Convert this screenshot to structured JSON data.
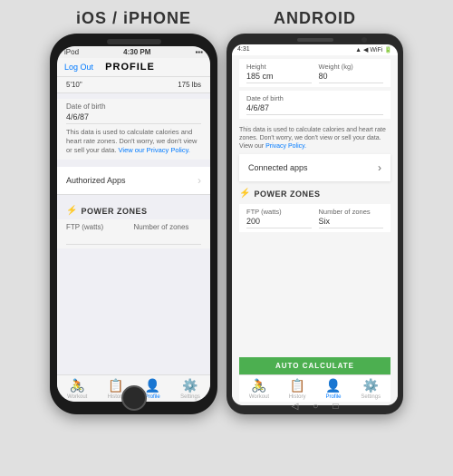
{
  "page": {
    "background": "#e0e0e0"
  },
  "ios": {
    "platform_title": "iOS / iPHONE",
    "status_bar": {
      "left": "iPod",
      "center": "4:30 PM",
      "right": "🔋"
    },
    "nav": {
      "back_label": "Log Out",
      "title": "PROFILE"
    },
    "profile": {
      "height_label": "5'10\"",
      "weight_label": "175 lbs"
    },
    "dob": {
      "label": "Date of birth",
      "value": "4/6/87"
    },
    "info_text": "This data is used to calculate calories and heart rate zones. Don't worry, we don't view or sell your data.",
    "privacy_link": "View our Privacy Policy.",
    "authorized_apps": {
      "label": "Authorized Apps"
    },
    "power_zones": {
      "header": "POWER ZONES",
      "ftp_label": "FTP (watts)",
      "ftp_value": "",
      "zones_label": "Number of zones",
      "zones_value": ""
    },
    "tabs": [
      {
        "icon": "🚴",
        "label": "Workout",
        "active": false
      },
      {
        "icon": "📋",
        "label": "History",
        "active": false
      },
      {
        "icon": "👤",
        "label": "Profile",
        "active": true
      },
      {
        "icon": "⚙️",
        "label": "Settings",
        "active": false
      }
    ]
  },
  "android": {
    "platform_title": "ANDROID",
    "status_bar": {
      "left": "4:31",
      "right": "▲ ◀ WiFi 🔋"
    },
    "profile": {
      "height_label": "Height",
      "height_value": "185 cm",
      "weight_label": "Weight (kg)",
      "weight_value": "80"
    },
    "dob": {
      "label": "Date of birth",
      "value": "4/6/87"
    },
    "info_text": "This data is used to calculate calories and heart rate zones. Don't worry, we don't view or sell your data. View our",
    "privacy_link": "Privacy Policy.",
    "connected_apps": {
      "label": "Connected apps"
    },
    "power_zones": {
      "header": "POWER ZONES",
      "ftp_label": "FTP (watts)",
      "ftp_value": "200",
      "zones_label": "Number of zones",
      "zones_value": "Six"
    },
    "autocalc_label": "AUTO CALCULATE",
    "tabs": [
      {
        "icon": "🚴",
        "label": "Workout",
        "active": false
      },
      {
        "icon": "📋",
        "label": "History",
        "active": false
      },
      {
        "icon": "👤",
        "label": "Profile",
        "active": true
      },
      {
        "icon": "⚙️",
        "label": "Settings",
        "active": false
      }
    ]
  }
}
